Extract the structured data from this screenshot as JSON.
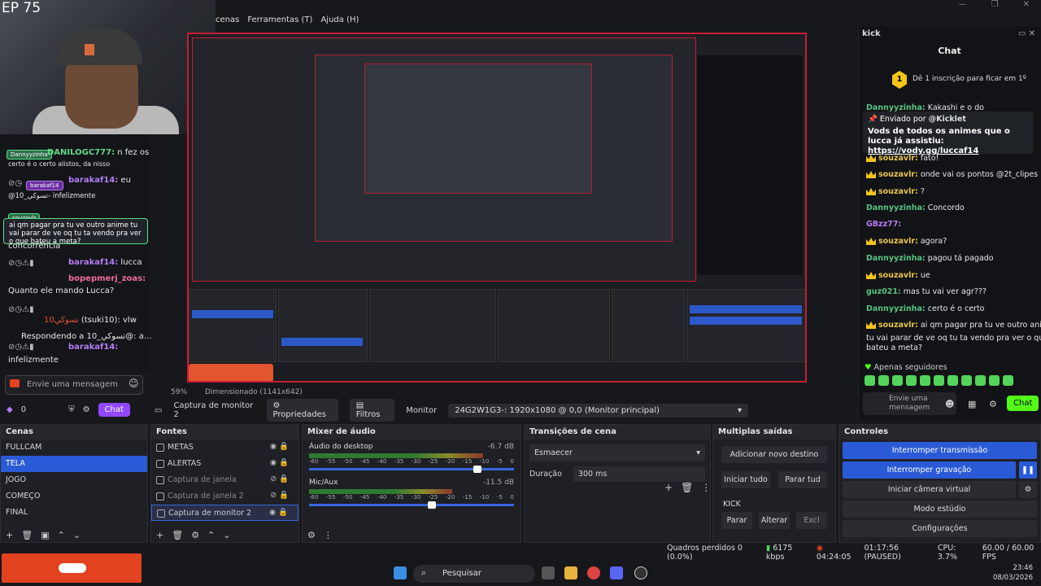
{
  "overlay": {
    "episode": "EP 75"
  },
  "menubar": {
    "items": [
      "cenas",
      "Ferramentas (T)",
      "Ajuda (H)"
    ]
  },
  "left_chat": {
    "lines": [
      {
        "user": "DANILOGC777:",
        "text": " n fez os",
        "color": "green"
      },
      {
        "user": "",
        "text": "certo é o certo    alistos, da nisso",
        "color": ""
      },
      {
        "user": "barakaf14:",
        "text": " eu",
        "color": "purple"
      },
      {
        "user": "",
        "text": "@10_تسوكي- infelizmente",
        "color": ""
      },
      {
        "user": "",
        "text": "concorrência",
        "color": ""
      },
      {
        "user": "barakaf14:",
        "text": " lucca",
        "color": "purple"
      },
      {
        "user": "bopepmerj_zoas:",
        "text": "",
        "color": "pink"
      },
      {
        "user": "",
        "text": "Quanto ele mando Lucca?",
        "color": ""
      },
      {
        "user": "تسوكي10",
        "text": " (tsuki10): vlw",
        "color": "red"
      },
      {
        "user": "",
        "text": "Respondendo a 10_تسوكي@: a...",
        "color": ""
      },
      {
        "user": "barakaf14:",
        "text": "",
        "color": "purple"
      },
      {
        "user": "",
        "text": "infelizmente",
        "color": ""
      }
    ],
    "pinned": "ai qm pagar pra tu ve outro anime tu vai parar de ve oq tu ta vendo pra ver o que bateu a meta?",
    "badge1": "Dannyyzinha",
    "badge2": "barakaf14",
    "badge3": "souzavlr",
    "input_placeholder": "Envie uma mensagem",
    "points": "0",
    "chat_button": "Chat"
  },
  "right_chat": {
    "tab": "kick",
    "title": "Chat",
    "sub_rank": "1",
    "sub_text": "Dê 1 inscrição para ficar em 1º",
    "pinned_by_label": "Enviado por",
    "pinned_by_user": "@Kicklet",
    "pinned_text": "Vods de todos os animes que o lucca já assistiu:",
    "pinned_link": "https://vody.gg/luccaf14",
    "top_line": {
      "user": "Dannyyzinha:",
      "text": " Kakashi e o do"
    },
    "messages": [
      {
        "user": "souzavlr:",
        "text": " fato!",
        "style": "u1",
        "crown": true
      },
      {
        "user": "souzavlr:",
        "text": " onde vai os pontos @2t_clipes",
        "style": "u1",
        "crown": true
      },
      {
        "user": "souzavlr:",
        "text": " ?",
        "style": "u1",
        "crown": true
      },
      {
        "user": "Dannyyzinha:",
        "text": " Concordo",
        "style": "u2",
        "crown": false
      },
      {
        "user": "GBzz77:",
        "text": "",
        "style": "u3",
        "crown": false
      },
      {
        "user": "souzavlr:",
        "text": " agora?",
        "style": "u1",
        "crown": true
      },
      {
        "user": "Dannyyzinha:",
        "text": " pagou tá pagado",
        "style": "u2",
        "crown": false
      },
      {
        "user": "souzavlr:",
        "text": " ue",
        "style": "u1",
        "crown": true
      },
      {
        "user": "guz021:",
        "text": " mas tu vai ver agr???",
        "style": "u2",
        "crown": false
      },
      {
        "user": "Dannyyzinha:",
        "text": " certo é o certo",
        "style": "u2",
        "crown": false
      },
      {
        "user": "souzavlr:",
        "text": " ai qm pagar pra tu ve outro anime",
        "style": "u1",
        "crown": true
      },
      {
        "user": "",
        "text": "tu vai parar de ve oq tu ta vendo pra ver o que",
        "style": "",
        "crown": false
      },
      {
        "user": "",
        "text": "bateu a meta?",
        "style": "",
        "crown": false
      }
    ],
    "followers_only": "Apenas seguidores",
    "input_placeholder": "Envie uma mensagem",
    "chat_button": "Chat"
  },
  "toolbar": {
    "source_name": "Captura de monitor 2",
    "properties": "Propriedades",
    "filters": "Filtros",
    "monitor_label": "Monitor",
    "monitor_value": "24G2W1G3-: 1920x1080 @ 0,0 (Monitor principal)"
  },
  "preview": {
    "zoom": "59%",
    "resize_label": "Dimensionado (1141x642)"
  },
  "scenes": {
    "title": "Cenas",
    "items": [
      "FULLCAM",
      "TELA",
      "JOGO",
      "COMEÇO",
      "FINAL"
    ],
    "selected": 1
  },
  "sources": {
    "title": "Fontes",
    "items": [
      {
        "name": "METAS",
        "dim": false
      },
      {
        "name": "ALERTAS",
        "dim": false
      },
      {
        "name": "Captura de janela",
        "dim": true
      },
      {
        "name": "Captura de janela 2",
        "dim": true
      },
      {
        "name": "Captura de monitor 2",
        "dim": false
      }
    ]
  },
  "mixer": {
    "title": "Mixer de áudio",
    "channels": [
      {
        "name": "Áudio do desktop",
        "db": "-6.7 dB",
        "level": 0.85,
        "volume": 0.82
      },
      {
        "name": "Mic/Aux",
        "db": "-11.5 dB",
        "level": 0.7,
        "volume": 0.6
      }
    ],
    "scale": [
      "-60",
      "-55",
      "-50",
      "-45",
      "-40",
      "-35",
      "-30",
      "-25",
      "-20",
      "-15",
      "-10",
      "-5",
      "0"
    ]
  },
  "transitions": {
    "title": "Transições de cena",
    "type": "Esmaecer",
    "duration_label": "Duração",
    "duration_value": "300 ms"
  },
  "multi_output": {
    "title": "Multiplas saídas",
    "add": "Adicionar novo destino",
    "start_all": "Iniciar tudo",
    "stop_all": "Parar tud",
    "target": "KICK",
    "stop": "Parar",
    "change": "Alterar",
    "delete": "Excl"
  },
  "controls": {
    "title": "Controles",
    "stop_stream": "Interromper transmissão",
    "stop_record": "Interromper gravação",
    "virtual_cam": "Iniciar câmera virtual",
    "studio_mode": "Modo estúdio",
    "settings": "Configurações"
  },
  "status": {
    "dropped": "Quadros perdidos 0 (0.0%)",
    "bitrate": "6175 kbps",
    "stream_time": "04:24:05",
    "rec_time": "01:17:56 (PAUSED)",
    "cpu": "CPU: 3.7%",
    "fps": "60.00 / 60.00 FPS"
  },
  "taskbar": {
    "search": "Pesquisar",
    "time": "23:46",
    "date": "08/03/2026"
  },
  "colors": {
    "accent": "#2a5ad6",
    "live_red": "#c81e35",
    "kick_green": "#53fc18",
    "twitch_purple": "#9147ff"
  }
}
